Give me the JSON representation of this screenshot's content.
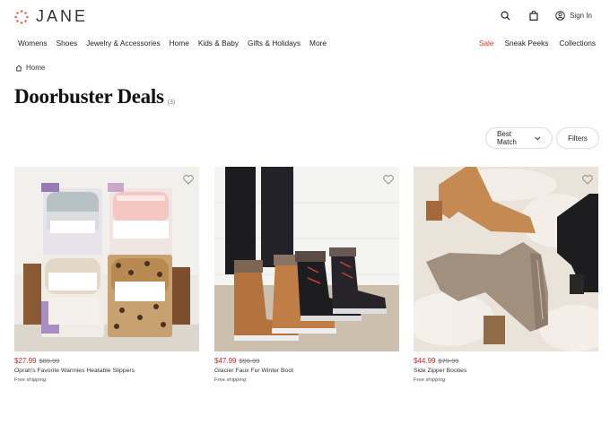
{
  "header": {
    "logo_text": "JANE",
    "signin_label": "Sign In"
  },
  "nav": {
    "left": [
      "Womens",
      "Shoes",
      "Jewelry & Accessories",
      "Home",
      "Kids & Baby",
      "Gifts & Holidays",
      "More"
    ],
    "right": [
      "Sale",
      "Sneak Peeks",
      "Collections"
    ]
  },
  "breadcrumb": {
    "home_label": "Home"
  },
  "page": {
    "title": "Doorbuster Deals",
    "count": "(3)"
  },
  "controls": {
    "sort_label": "Best Match",
    "filters_label": "Filters"
  },
  "products": [
    {
      "price_now": "$27.99",
      "price_was": "$89.99",
      "name": "Oprah's Favorite Warmies Heatable Slippers",
      "shipping": "Free shipping"
    },
    {
      "price_now": "$47.99",
      "price_was": "$99.99",
      "name": "Glacier Faux Fur Winter Boot",
      "shipping": "Free shipping"
    },
    {
      "price_now": "$44.99",
      "price_was": "$79.99",
      "name": "Side Zipper Booties",
      "shipping": "Free shipping"
    }
  ],
  "colors": {
    "sale": "#d33a2c",
    "price": "#c62828",
    "logo_accent": "#e8685a"
  }
}
